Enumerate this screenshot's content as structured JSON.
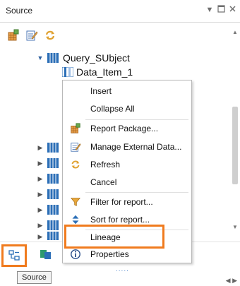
{
  "panel": {
    "title": "Source",
    "header_icons": [
      "chevron-down-icon",
      "maximize-icon",
      "close-icon"
    ]
  },
  "toolbar": {
    "icons": [
      "package-icon",
      "manage-data-icon",
      "refresh-icon"
    ]
  },
  "tree": {
    "query_subject": "Query_SUbject",
    "data_item": "Data_Item_1",
    "collapsed_rows": 7
  },
  "context_menu": {
    "items": [
      {
        "label": "Insert",
        "icon": ""
      },
      {
        "label": "Collapse All",
        "icon": ""
      },
      {
        "label": "Report Package...",
        "icon": "package-icon"
      },
      {
        "label": "Manage External Data...",
        "icon": "manage-data-icon"
      },
      {
        "label": "Refresh",
        "icon": "refresh-icon"
      },
      {
        "label": "Cancel",
        "icon": ""
      },
      {
        "label": "Filter for report...",
        "icon": "filter-icon"
      },
      {
        "label": "Sort for report...",
        "icon": "sort-icon"
      },
      {
        "label": "Lineage",
        "icon": ""
      },
      {
        "label": "Properties",
        "icon": "info-icon"
      }
    ]
  },
  "bottom_bar": {
    "tooltip": "Source",
    "dots": "....."
  },
  "colors": {
    "highlight": "#f07b1e",
    "tree_blue": "#2c6fb7"
  }
}
